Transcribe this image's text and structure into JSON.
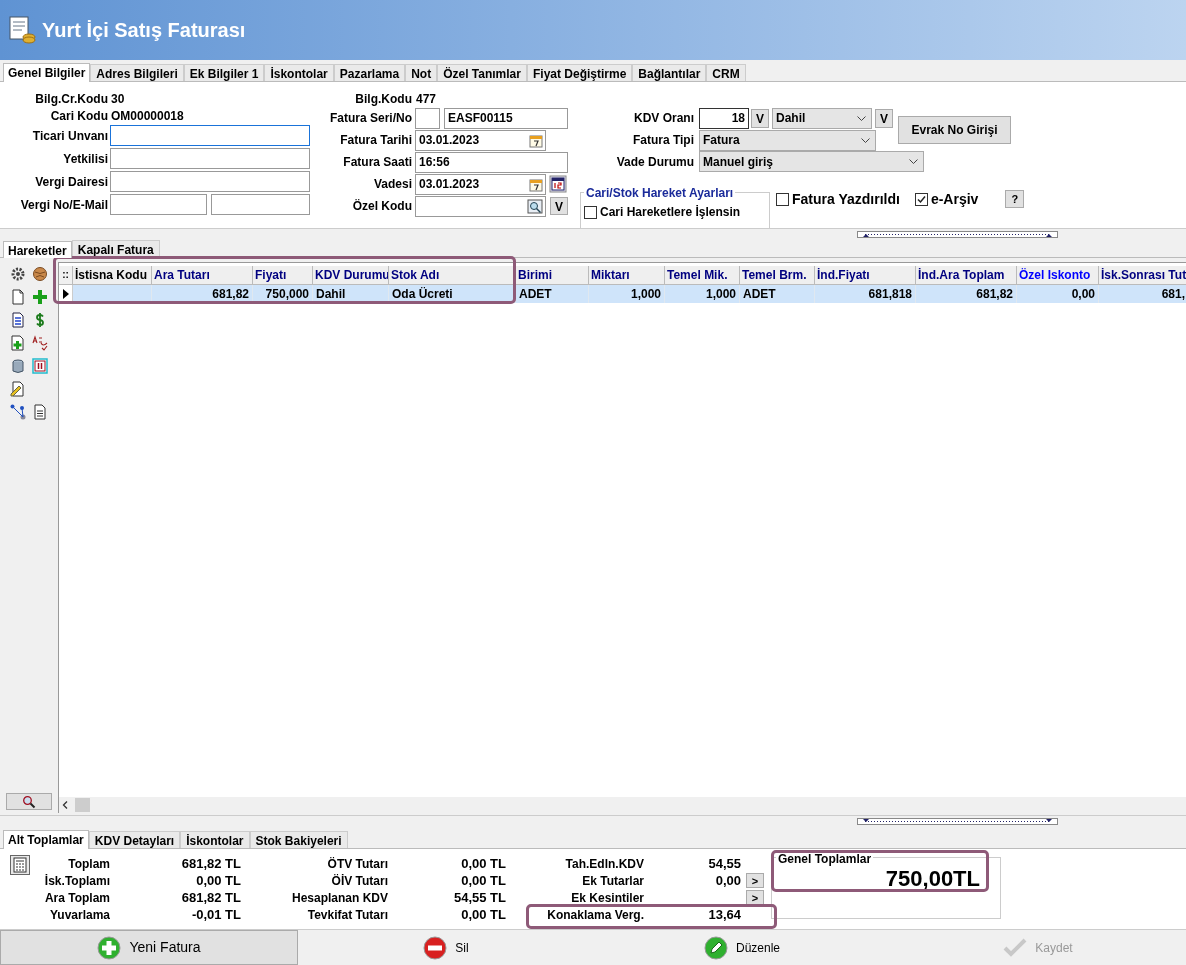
{
  "window": {
    "title": "Yurt İçi Satış Faturası"
  },
  "tabs": [
    {
      "label": "Genel Bilgiler",
      "selected": true
    },
    {
      "label": "Adres Bilgileri",
      "selected": false
    },
    {
      "label": "Ek Bilgiler 1",
      "selected": false
    },
    {
      "label": "İskontolar",
      "selected": false
    },
    {
      "label": "Pazarlama",
      "selected": false
    },
    {
      "label": "Not",
      "selected": false
    },
    {
      "label": "Özel Tanımlar",
      "selected": false
    },
    {
      "label": "Fiyat Değiştirme",
      "selected": false
    },
    {
      "label": "Bağlantılar",
      "selected": false
    },
    {
      "label": "CRM",
      "selected": false
    }
  ],
  "form": {
    "left": [
      {
        "kind": "info",
        "label": "Bilg.Cr.Kodu",
        "value": "30"
      },
      {
        "kind": "info",
        "label": "Cari Kodu",
        "value": "OM00000018"
      },
      {
        "kind": "field",
        "label": "Ticari Unvanı",
        "focused": true
      },
      {
        "kind": "field",
        "label": "Yetkilisi",
        "focused": false
      },
      {
        "kind": "field",
        "label": "Vergi Dairesi",
        "focused": false
      },
      {
        "kind": "pair",
        "label": "Vergi No/E-Mail"
      }
    ],
    "middle": [
      {
        "kind": "info",
        "label": "Bilg.Kodu",
        "value": "477"
      },
      {
        "kind": "serial",
        "label": "Fatura Seri/No",
        "value": "EASF00115"
      },
      {
        "kind": "date",
        "label": "Fatura Tarihi",
        "value": "03.01.2023",
        "calendar_button": false
      },
      {
        "kind": "text",
        "label": "Fatura Saati",
        "value": "16:56"
      },
      {
        "kind": "date",
        "label": "Vadesi",
        "value": "03.01.2023",
        "calendar_button": true
      },
      {
        "kind": "lookup",
        "label": "Özel Kodu",
        "button": "V"
      }
    ],
    "kdv": {
      "label": "KDV Oranı",
      "value": "18",
      "button": "V",
      "mode": "Dahil",
      "mode_button": "V"
    },
    "evrak_button": "Evrak No Girişi",
    "fatura_tipi": {
      "label": "Fatura Tipi",
      "value": "Fatura"
    },
    "vade_durumu": {
      "label": "Vade Durumu",
      "value": "Manuel giriş"
    },
    "hareket_group": {
      "title": "Cari/Stok Hareket Ayarları",
      "options": [
        {
          "label": "Cari Hareketlere İşlensin",
          "checked": false
        }
      ]
    },
    "flags": [
      {
        "label": "Fatura Yazdırıldı",
        "checked": false
      },
      {
        "label": "e-Arşiv",
        "checked": true,
        "help": "?"
      }
    ]
  },
  "lower_tabs": [
    {
      "label": "Hareketler",
      "selected": true
    },
    {
      "label": "Kapalı Fatura",
      "selected": false
    }
  ],
  "grid": {
    "corner": "::",
    "columns": [
      {
        "label": "İstisna Kodu",
        "kind": "text",
        "color": "#000000"
      },
      {
        "label": "Ara Tutarı",
        "kind": "number",
        "color": "#000080"
      },
      {
        "label": "Fiyatı",
        "kind": "number",
        "color": "#000080"
      },
      {
        "label": "KDV Durumu",
        "kind": "text",
        "color": "#000080"
      },
      {
        "label": "Stok Adı",
        "kind": "text",
        "color": "#000080"
      },
      {
        "label": "Birimi",
        "kind": "text",
        "color": "#000080"
      },
      {
        "label": "Miktarı",
        "kind": "number",
        "color": "#000080"
      },
      {
        "label": "Temel Mik.",
        "kind": "number",
        "color": "#000080"
      },
      {
        "label": "Temel Brm.",
        "kind": "text",
        "color": "#000080"
      },
      {
        "label": "İnd.Fiyatı",
        "kind": "number",
        "color": "#000080"
      },
      {
        "label": "İnd.Ara Toplam",
        "kind": "number",
        "color": "#000080"
      },
      {
        "label": "Özel Iskonto",
        "kind": "number",
        "color": "#0000ff"
      },
      {
        "label": "İsk.Sonrası Tut",
        "kind": "number",
        "color": "#000080"
      }
    ],
    "rows": [
      {
        "selected": true,
        "cells": [
          null,
          "681,82",
          "750,000",
          "Dahil",
          "Oda Ücreti",
          "ADET",
          "1,000",
          "1,000",
          "ADET",
          "681,818",
          "681,82",
          "0,00",
          "681,"
        ]
      }
    ]
  },
  "bottom_tabs": [
    {
      "label": "Alt Toplamlar",
      "selected": true
    },
    {
      "label": "KDV Detayları",
      "selected": false
    },
    {
      "label": "İskontolar",
      "selected": false
    },
    {
      "label": "Stok Bakiyeleri",
      "selected": false
    }
  ],
  "totals": {
    "col1": [
      {
        "label": "Toplam",
        "value": "681,82 TL"
      },
      {
        "label": "İsk.Toplamı",
        "value": "0,00 TL"
      },
      {
        "label": "Ara Toplam",
        "value": "681,82 TL"
      },
      {
        "label": "Yuvarlama",
        "value": "-0,01 TL"
      }
    ],
    "col2": [
      {
        "label": "ÖTV Tutarı",
        "value": "0,00 TL"
      },
      {
        "label": "ÖİV Tutarı",
        "value": "0,00 TL"
      },
      {
        "label": "Hesaplanan KDV",
        "value": "54,55 TL"
      },
      {
        "label": "Tevkifat Tutarı",
        "value": "0,00 TL"
      }
    ],
    "col3": [
      {
        "label": "Tah.Edln.KDV",
        "value": "54,55"
      },
      {
        "label": "Ek Tutarlar",
        "value": "0,00",
        "button": ">"
      },
      {
        "label": "Ek Kesintiler",
        "button": ">"
      },
      {
        "label": "Konaklama Verg.",
        "value": "13,64"
      }
    ],
    "genel": {
      "title": "Genel Toplamlar",
      "value": "750,00TL"
    }
  },
  "actions": [
    {
      "label": "Yeni Fatura",
      "kind": "new",
      "focused": true,
      "disabled": false
    },
    {
      "label": "Sil",
      "kind": "delete",
      "focused": false,
      "disabled": false
    },
    {
      "label": "Düzenle",
      "kind": "edit",
      "focused": false,
      "disabled": false
    },
    {
      "label": "Kaydet",
      "kind": "save",
      "focused": false,
      "disabled": true
    }
  ]
}
